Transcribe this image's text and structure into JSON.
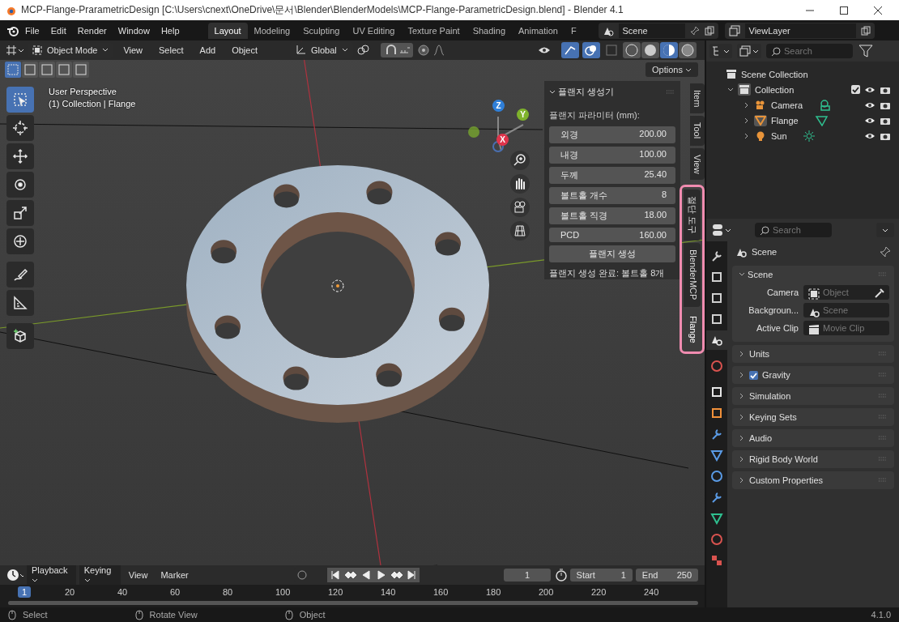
{
  "window": {
    "title": "MCP-Flange-PrarametricDesign [C:\\Users\\cnext\\OneDrive\\문서\\Blender\\BlenderModels\\MCP-Flange-ParametricDesign.blend] - Blender 4.1"
  },
  "menu": [
    "File",
    "Edit",
    "Render",
    "Window",
    "Help"
  ],
  "workspaces": [
    {
      "label": "Layout",
      "selected": true
    },
    {
      "label": "Modeling",
      "selected": false
    },
    {
      "label": "Sculpting",
      "selected": false
    },
    {
      "label": "UV Editing",
      "selected": false
    },
    {
      "label": "Texture Paint",
      "selected": false
    },
    {
      "label": "Shading",
      "selected": false
    },
    {
      "label": "Animation",
      "selected": false
    },
    {
      "label": "F",
      "selected": false
    }
  ],
  "scene": {
    "value": "Scene"
  },
  "view_layer": {
    "value": "ViewLayer"
  },
  "viewport": {
    "mode": "Object Mode",
    "menus": [
      "View",
      "Select",
      "Add",
      "Object"
    ],
    "orientation": "Global",
    "options": "Options",
    "select_modes": [
      {
        "selected": true
      },
      {
        "selected": false
      },
      {
        "selected": false
      },
      {
        "selected": false
      },
      {
        "selected": false
      }
    ],
    "shading_modes": [
      {
        "kind": "wireframe",
        "selected": false
      },
      {
        "kind": "solid",
        "selected": false
      },
      {
        "kind": "material",
        "selected": true
      },
      {
        "kind": "rendered",
        "selected": false
      }
    ],
    "overlay_text": [
      "User Perspective",
      "(1) Collection | Flange"
    ],
    "gizmo_axes": [
      {
        "label": "Z",
        "color": "#2f7fd8"
      },
      {
        "label": "Y",
        "color": "#7fb32c"
      },
      {
        "label": "X",
        "color": "#e0344b"
      }
    ]
  },
  "toolbar": [
    {
      "kind": "select",
      "selected": true
    },
    {
      "kind": "cursor",
      "selected": false
    },
    {
      "kind": "move",
      "selected": false
    },
    {
      "kind": "rotate",
      "selected": false
    },
    {
      "kind": "scale",
      "selected": false
    },
    {
      "kind": "transform",
      "selected": false
    },
    {
      "kind": "annotate",
      "selected": false
    },
    {
      "kind": "measure",
      "selected": false
    },
    {
      "kind": "add_cube",
      "selected": false
    }
  ],
  "sidebar_panel": {
    "title": "플랜지 생성기",
    "section_label": "플랜지 파라미터 (mm):",
    "fields": [
      {
        "label": "외경",
        "value": "200.00"
      },
      {
        "label": "내경",
        "value": "100.00"
      },
      {
        "label": "두께",
        "value": "25.40"
      },
      {
        "label": "볼트홀 개수",
        "value": "8"
      },
      {
        "label": "볼트홀 직경",
        "value": "18.00"
      },
      {
        "label": "PCD",
        "value": "160.00"
      }
    ],
    "button": "플랜지 생성",
    "status": "플랜지 생성 완료: 볼트홀 8개"
  },
  "sidebar_tabs": [
    {
      "label": "Item",
      "selected": false,
      "highlighted": false
    },
    {
      "label": "Tool",
      "selected": false,
      "highlighted": false
    },
    {
      "label": "View",
      "selected": false,
      "highlighted": false
    },
    {
      "label": "절단 도구",
      "selected": false,
      "highlighted": true
    },
    {
      "label": "BlenderMCP",
      "selected": false,
      "highlighted": true
    },
    {
      "label": "Flange",
      "selected": true,
      "highlighted": true
    }
  ],
  "outliner": {
    "search_placeholder": "Search",
    "tree": [
      {
        "label": "Scene Collection",
        "kind": "scene_collection",
        "children": [
          {
            "label": "Collection",
            "kind": "collection",
            "expanded": true,
            "checked": true,
            "children": [
              {
                "label": "Camera",
                "kind": "camera",
                "selected": false
              },
              {
                "label": "Flange",
                "kind": "mesh",
                "selected": true
              },
              {
                "label": "Sun",
                "kind": "light",
                "selected": false
              }
            ]
          }
        ]
      }
    ]
  },
  "properties": {
    "search_placeholder": "Search",
    "context": "Scene",
    "tabs": [
      {
        "kind": "tool",
        "selected": false
      },
      {
        "kind": "render",
        "selected": false
      },
      {
        "kind": "output",
        "selected": false
      },
      {
        "kind": "view_layer",
        "selected": false
      },
      {
        "kind": "scene",
        "selected": true
      },
      {
        "kind": "world",
        "selected": false
      },
      {
        "kind": "collection",
        "selected": false
      },
      {
        "kind": "object",
        "selected": false
      },
      {
        "kind": "modifiers",
        "selected": false
      },
      {
        "kind": "particles",
        "selected": false
      },
      {
        "kind": "physics",
        "selected": false
      },
      {
        "kind": "constraints",
        "selected": false
      },
      {
        "kind": "data",
        "selected": false
      },
      {
        "kind": "material",
        "selected": false
      },
      {
        "kind": "texture",
        "selected": false
      }
    ],
    "scene_panel": {
      "title": "Scene",
      "expanded": true,
      "rows": [
        {
          "label": "Camera",
          "placeholder": "Object",
          "kind": "object"
        },
        {
          "label": "Backgroun...",
          "placeholder": "Scene",
          "kind": "scene"
        },
        {
          "label": "Active Clip",
          "placeholder": "Movie Clip",
          "kind": "clip"
        }
      ]
    },
    "panels": [
      {
        "title": "Units"
      },
      {
        "title": "Gravity",
        "checked": true
      },
      {
        "title": "Simulation"
      },
      {
        "title": "Keying Sets"
      },
      {
        "title": "Audio"
      },
      {
        "title": "Rigid Body World"
      },
      {
        "title": "Custom Properties"
      }
    ]
  },
  "timeline": {
    "menus": [
      "Playback",
      "Keying",
      "View",
      "Marker"
    ],
    "current_frame": "1",
    "start_label": "Start",
    "start": "1",
    "end_label": "End",
    "end": "250",
    "ruler_current": "1",
    "ruler_labels": [
      "20",
      "40",
      "60",
      "80",
      "100",
      "120",
      "140",
      "160",
      "180",
      "200",
      "220",
      "240"
    ]
  },
  "status_bar": {
    "hints": [
      "Select",
      "Rotate View",
      "Object"
    ],
    "version": "4.1.0"
  }
}
